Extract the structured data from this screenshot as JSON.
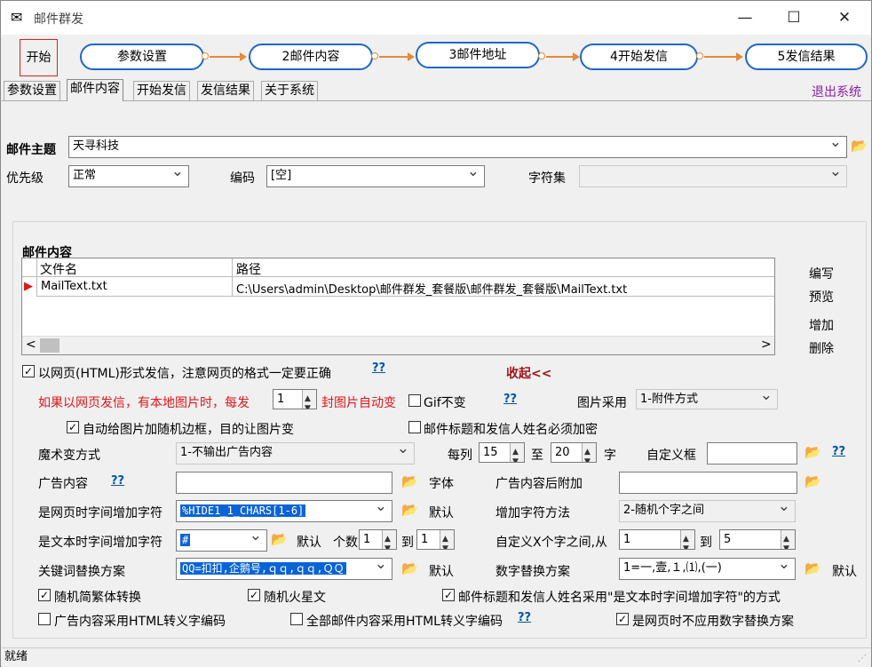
{
  "window": {
    "title": "邮件群发",
    "minimize": "—",
    "maximize": "☐",
    "close": "✕"
  },
  "toolbar": {
    "start": "开始",
    "steps": [
      "参数设置",
      "2邮件内容",
      "3邮件地址",
      "4开始发信",
      "5发信结果"
    ],
    "exit": "退出系统"
  },
  "tabs": [
    "参数设置",
    "邮件内容",
    "开始发信",
    "发信结果",
    "关于系统"
  ],
  "active_tab": "邮件内容",
  "form": {
    "subject_label": "邮件主题",
    "subject_value": "天寻科技",
    "priority_label": "优先级",
    "priority_value": "正常",
    "encoding_label": "编码",
    "encoding_value": "[空]",
    "charset_label": "字符集",
    "charset_value": ""
  },
  "content": {
    "section_title": "邮件内容",
    "columns": [
      "文件名",
      "路径"
    ],
    "rows": [
      {
        "file": "MailText.txt",
        "path": "C:\\Users\\admin\\Desktop\\邮件群发_套餐版\\邮件群发_套餐版\\MailText.txt"
      }
    ],
    "actions": [
      "编写",
      "预览",
      "增加",
      "删除"
    ]
  },
  "options": {
    "html_send": "以网页(HTML)形式发信，注意网页的格式一定要正确",
    "help": "??",
    "collapse": "收起<<",
    "local_image_1": "如果以网页发信，有本地图片时，每发",
    "local_image_count": "1",
    "local_image_2": "封图片自动变",
    "gif_no_change": "Gif不变",
    "image_mode_label": "图片采用",
    "image_mode_value": "1-附件方式",
    "random_border": "自动给图片加随机边框，目的让图片变",
    "must_encrypt": "邮件标题和发信人姓名必须加密",
    "magic_label": "魔术变方式",
    "magic_value": "1-不输出广告内容",
    "per_col_label": "每列",
    "per_col_from": "15",
    "to": "至",
    "per_col_to": "20",
    "char_unit": "字",
    "custom_box_label": "自定义框",
    "custom_box_value": "",
    "ad_label": "广告内容",
    "ad_value": "",
    "font_label": "字体",
    "ad_append_label": "广告内容后附加",
    "ad_append_value": "",
    "web_char_label": "是网页时字间增加字符",
    "web_char_value": "%HIDE1_1_CHARS[1-6]",
    "default_label": "默认",
    "add_method_label": "增加字符方法",
    "add_method_value": "2-随机个字之间",
    "text_char_label": "是文本时字间增加字符",
    "text_char_value": "#",
    "count_label": "个数",
    "count_from": "1",
    "count_to_label": "到",
    "count_to": "1",
    "custom_x_label": "自定义X个字之间,从",
    "custom_x_from": "1",
    "custom_x_to": "5",
    "keyword_label": "关键词替换方案",
    "keyword_value": "QQ=扣扣,企鹅号,ｑｑ,ｑｑ,ＱＱ",
    "digit_label": "数字替换方案",
    "digit_value": "1=一,壹,１,⑴,(一)",
    "random_trad": "随机简繁体转换",
    "random_mars": "随机火星文",
    "subject_text_char": "邮件标题和发信人姓名采用\"是文本时字间增加字符\"的方式",
    "ad_html_escape": "广告内容采用HTML转义字编码",
    "all_html_escape": "全部邮件内容采用HTML转义字编码",
    "web_no_digit": "是网页时不应用数字替换方案"
  },
  "status": "就绪"
}
